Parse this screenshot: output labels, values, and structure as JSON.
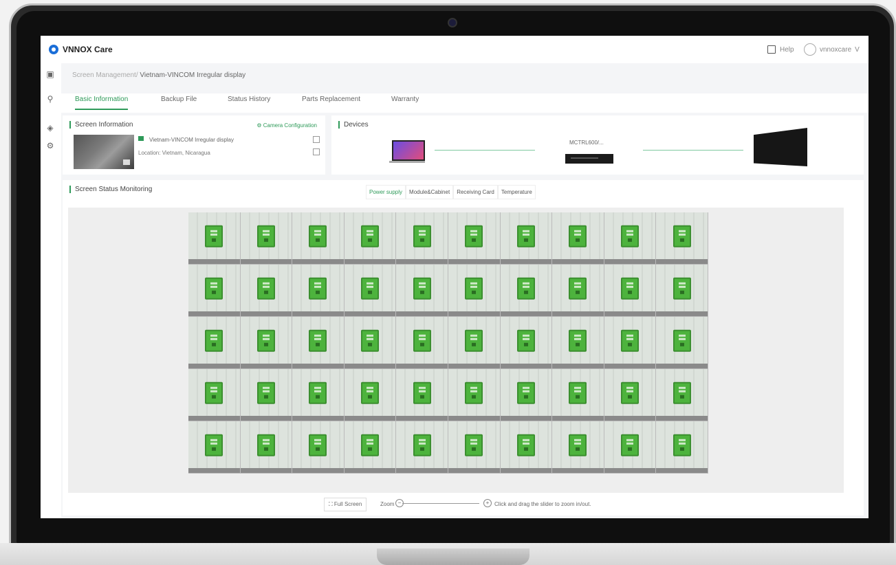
{
  "app": {
    "brand": "VNNOX Care",
    "help_label": "Help",
    "user_name": "vnnoxcare",
    "user_caret": "V"
  },
  "breadcrumb": {
    "parent": "Screen Management/",
    "current": " Vietnam-VINCOM Irregular display"
  },
  "tabs": [
    {
      "label": "Basic Information",
      "active": true
    },
    {
      "label": "Backup File",
      "active": false
    },
    {
      "label": "Status History",
      "active": false
    },
    {
      "label": "Parts Replacement",
      "active": false
    },
    {
      "label": "Warranty",
      "active": false
    }
  ],
  "screen_info": {
    "title": "Screen Information",
    "camera_config": "Camera Configuration",
    "screen_name": "Vietnam-VINCOM Irregular display",
    "location": "Location: Vietnam, Nicaragua"
  },
  "devices": {
    "title": "Devices",
    "controller_label": "MCTRL600/..."
  },
  "monitoring": {
    "title": "Screen Status Monitoring",
    "segments": [
      {
        "label": "Power supply",
        "active": true
      },
      {
        "label": "Module&Cabinet",
        "active": false
      },
      {
        "label": "Receiving Card",
        "active": false
      },
      {
        "label": "Temperature",
        "active": false
      }
    ],
    "grid_rows": 5,
    "grid_cols": 10
  },
  "zoom_bar": {
    "full_screen": "Full Screen",
    "zoom_label": "Zoom",
    "minus": "−",
    "plus": "+",
    "hint": "Click and drag the slider to zoom in/out."
  },
  "colors": {
    "accent": "#2e9a59",
    "psu_ok": "#4db33d"
  }
}
